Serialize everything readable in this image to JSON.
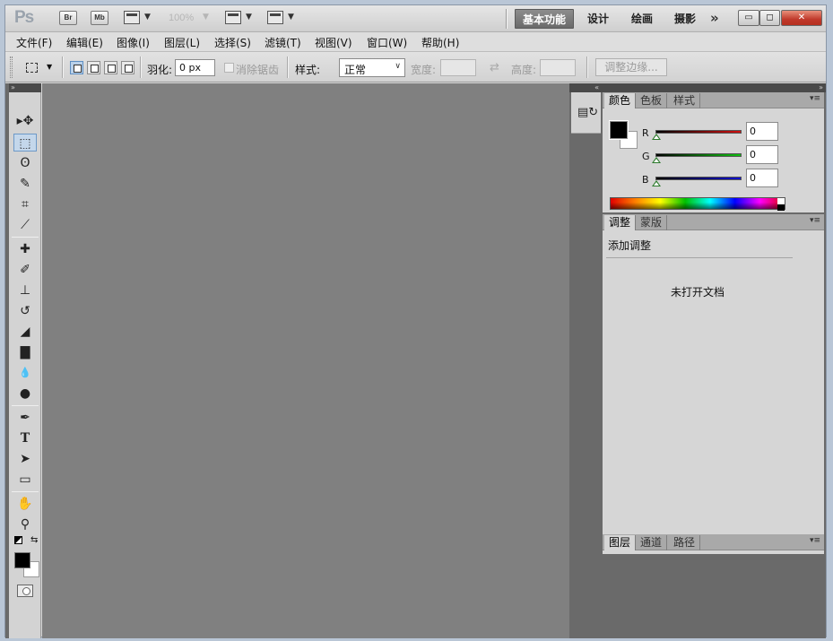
{
  "app": {
    "logo": "Ps",
    "bridge_label": "Br",
    "minibridge_label": "Mb",
    "zoom": "100%",
    "workspaces": [
      "基本功能",
      "设计",
      "绘画",
      "摄影"
    ],
    "more": "»",
    "win_min": "▭",
    "win_max": "◻",
    "win_close": "✕"
  },
  "menu": [
    "文件(F)",
    "编辑(E)",
    "图像(I)",
    "图层(L)",
    "选择(S)",
    "滤镜(T)",
    "视图(V)",
    "窗口(W)",
    "帮助(H)"
  ],
  "options": {
    "feather_label": "羽化:",
    "feather_value": "0 px",
    "antialias_label": "消除锯齿",
    "style_label": "样式:",
    "style_value": "正常",
    "width_label": "宽度:",
    "height_label": "高度:",
    "refine_edge": "调整边缘..."
  },
  "tools": [
    {
      "name": "move-tool-icon",
      "glyph": "▸✥"
    },
    {
      "name": "marquee-tool-icon",
      "glyph": "⬚"
    },
    {
      "name": "lasso-tool-icon",
      "glyph": "ʘ"
    },
    {
      "name": "quick-selection-tool-icon",
      "glyph": "✎"
    },
    {
      "name": "crop-tool-icon",
      "glyph": "⌗"
    },
    {
      "name": "eyedropper-tool-icon",
      "glyph": "⟋"
    },
    {
      "name": "healing-brush-tool-icon",
      "glyph": "✚"
    },
    {
      "name": "brush-tool-icon",
      "glyph": "✐"
    },
    {
      "name": "clone-stamp-tool-icon",
      "glyph": "⊥"
    },
    {
      "name": "history-brush-tool-icon",
      "glyph": "↺"
    },
    {
      "name": "eraser-tool-icon",
      "glyph": "◢"
    },
    {
      "name": "gradient-tool-icon",
      "glyph": "▇"
    },
    {
      "name": "blur-tool-icon",
      "glyph": "💧"
    },
    {
      "name": "dodge-tool-icon",
      "glyph": "●"
    },
    {
      "name": "pen-tool-icon",
      "glyph": "✒"
    },
    {
      "name": "type-tool-icon",
      "glyph": "T"
    },
    {
      "name": "path-selection-tool-icon",
      "glyph": "➤"
    },
    {
      "name": "rectangle-tool-icon",
      "glyph": "▭"
    },
    {
      "name": "hand-tool-icon",
      "glyph": "✋"
    },
    {
      "name": "zoom-tool-icon",
      "glyph": "⚲"
    }
  ],
  "color_panel": {
    "tabs": [
      "颜色",
      "色板",
      "样式"
    ],
    "channels": [
      {
        "label": "R",
        "value": "0",
        "color": "#d01010"
      },
      {
        "label": "G",
        "value": "0",
        "color": "#10c010"
      },
      {
        "label": "B",
        "value": "0",
        "color": "#1010d0"
      }
    ]
  },
  "adjust_panel": {
    "tabs": [
      "调整",
      "蒙版"
    ],
    "heading": "添加调整",
    "empty": "未打开文档"
  },
  "layers_panel": {
    "tabs": [
      "图层",
      "通道",
      "路径"
    ]
  },
  "panel_menu": "▾≡",
  "collapse_left": "»",
  "collapse_right": "«",
  "expand_right": "»"
}
